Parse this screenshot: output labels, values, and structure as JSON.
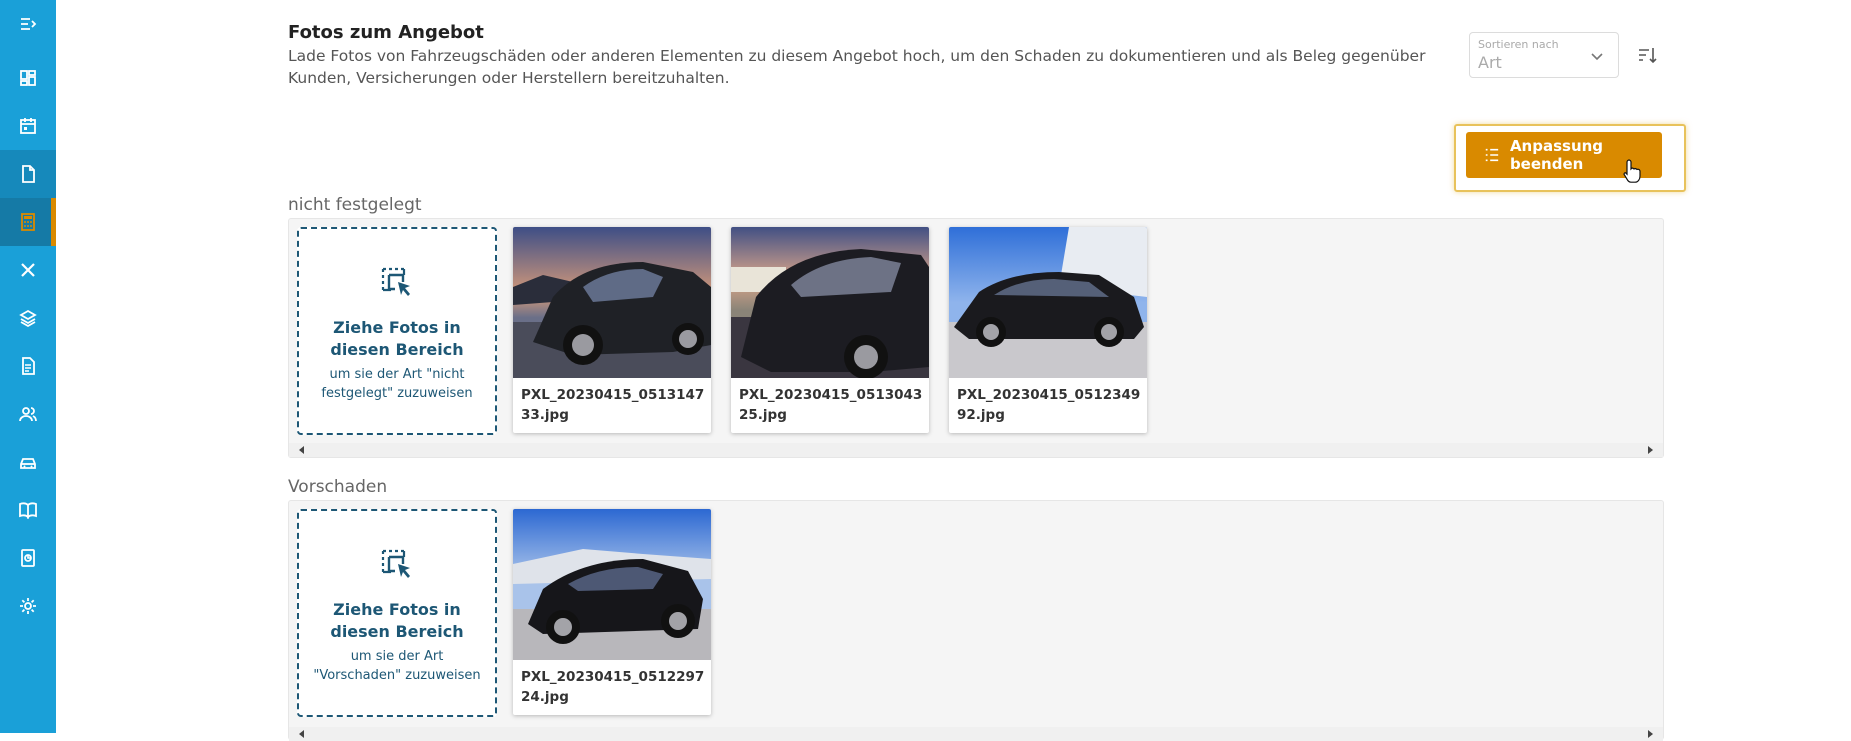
{
  "sidebar": {
    "items": [
      {
        "icon": "collapse-menu-icon"
      },
      {
        "icon": "dashboard-icon"
      },
      {
        "icon": "calendar-icon"
      },
      {
        "icon": "document-icon"
      },
      {
        "icon": "calculator-icon"
      },
      {
        "icon": "tools-icon"
      },
      {
        "icon": "layers-icon"
      },
      {
        "icon": "invoice-icon"
      },
      {
        "icon": "customers-icon"
      },
      {
        "icon": "car-icon"
      },
      {
        "icon": "book-icon"
      },
      {
        "icon": "report-icon"
      },
      {
        "icon": "settings-icon"
      }
    ],
    "active_color": "#d98a00",
    "background": "#1aa0d8"
  },
  "header": {
    "title": "Fotos zum Angebot",
    "description": "Lade Fotos von Fahrzeugschäden oder anderen Elementen zu diesem Angebot hoch, um den Schaden zu dokumentieren und als Beleg gegenüber Kunden, Versicherungen oder Herstellern bereitzuhalten."
  },
  "sort": {
    "label": "Sortieren nach",
    "value": "Art"
  },
  "toolbar": {
    "finish_label": "Anpassung beenden",
    "accent": "#d98a00"
  },
  "groups": [
    {
      "label": "nicht festgelegt",
      "dropzone_title": "Ziehe Fotos in diesen Bereich",
      "dropzone_sub": "um sie der Art \"nicht festgelegt\" zuzuweisen",
      "photos": [
        {
          "name": "PXL_20230415_051314733.jpg"
        },
        {
          "name": "PXL_20230415_051304325.jpg"
        },
        {
          "name": "PXL_20230415_051234992.jpg"
        }
      ]
    },
    {
      "label": "Vorschaden",
      "dropzone_title": "Ziehe Fotos in diesen Bereich",
      "dropzone_sub": "um sie der Art \"Vorschaden\" zuzuweisen",
      "photos": [
        {
          "name": "PXL_20230415_051229724.jpg"
        }
      ]
    }
  ]
}
